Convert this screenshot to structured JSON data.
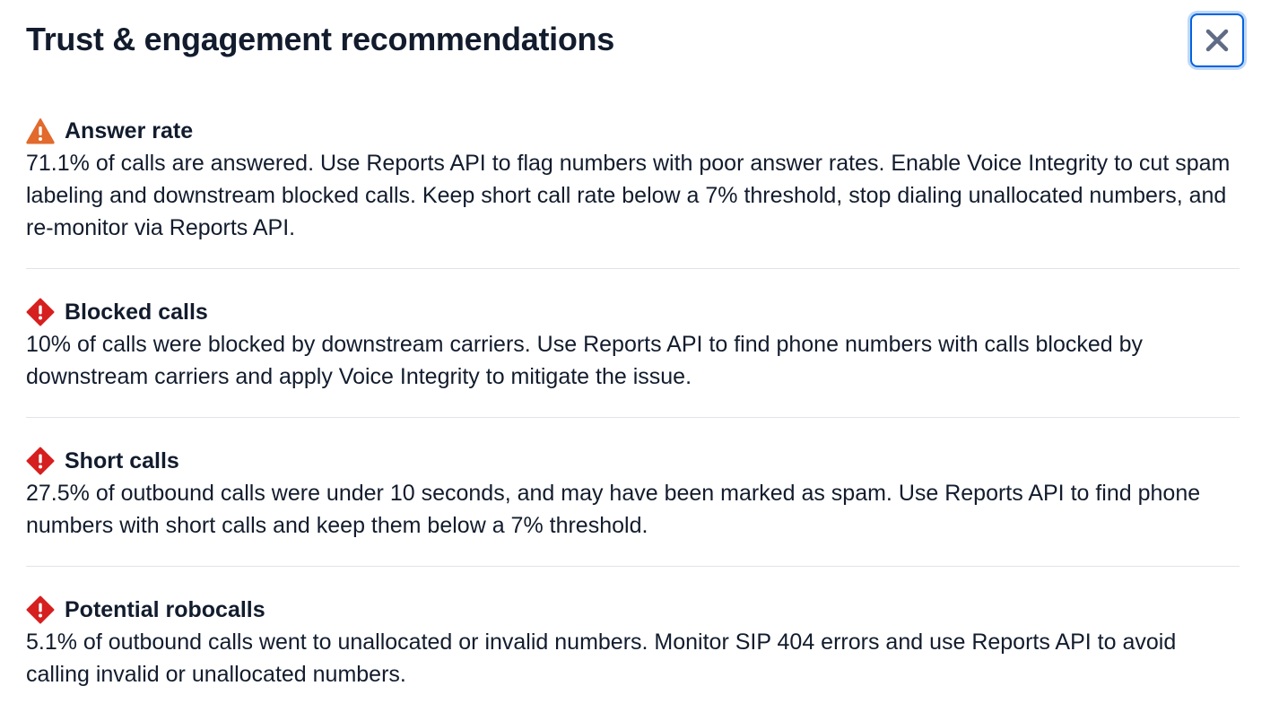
{
  "dialog": {
    "title": "Trust & engagement recommendations",
    "close_icon": "close-icon"
  },
  "colors": {
    "warning": "#e16a2c",
    "error": "#d61f1f",
    "focus_ring": "#0263e0",
    "divider": "#e1e3ea",
    "text": "#121c2d"
  },
  "recommendations": [
    {
      "icon": "warning-icon",
      "title": "Answer rate",
      "body": "71.1% of calls are answered. Use Reports API to flag numbers with poor answer rates. Enable Voice Integrity to cut spam labeling and downstream blocked calls. Keep short call rate below a 7% threshold, stop dialing unallocated numbers, and re-monitor via Reports API."
    },
    {
      "icon": "error-icon",
      "title": "Blocked calls",
      "body": "10% of calls were blocked by downstream carriers. Use Reports API to find phone numbers with calls blocked by downstream carriers and apply Voice Integrity to mitigate the issue."
    },
    {
      "icon": "error-icon",
      "title": "Short calls",
      "body": "27.5% of outbound calls were under 10 seconds, and may have been marked as spam. Use Reports API to find phone numbers with short calls and keep them below a 7% threshold."
    },
    {
      "icon": "error-icon",
      "title": "Potential robocalls",
      "body": "5.1% of outbound calls went to unallocated or invalid numbers. Monitor SIP 404 errors and use Reports API to avoid calling invalid or unallocated numbers."
    }
  ]
}
